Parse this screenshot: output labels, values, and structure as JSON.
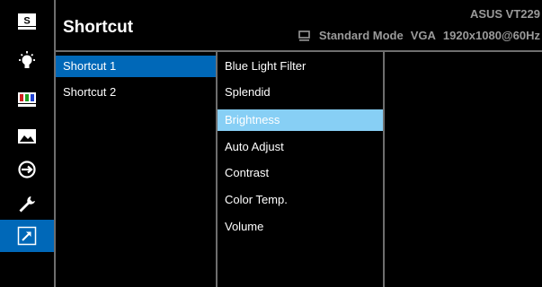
{
  "header": {
    "title": "Shortcut",
    "model": "ASUS VT229",
    "status": {
      "mode": "Standard Mode",
      "input": "VGA",
      "resolution": "1920x1080@60Hz"
    }
  },
  "sidebar": {
    "items": [
      {
        "icon": "splendid-s-icon"
      },
      {
        "icon": "blue-light-filter-icon"
      },
      {
        "icon": "color-icon"
      },
      {
        "icon": "image-icon"
      },
      {
        "icon": "input-select-icon"
      },
      {
        "icon": "system-setup-wrench-icon"
      },
      {
        "icon": "shortcut-arrow-icon",
        "active": true
      }
    ]
  },
  "shortcut_list": [
    {
      "label": "Shortcut 1",
      "selected": true
    },
    {
      "label": "Shortcut 2",
      "selected": false
    }
  ],
  "options": [
    {
      "label": "Blue Light Filter"
    },
    {
      "label": "Splendid"
    },
    {
      "label": "Brightness",
      "highlighted": true
    },
    {
      "label": "Auto Adjust"
    },
    {
      "label": "Contrast"
    },
    {
      "label": "Color Temp."
    },
    {
      "label": "Volume"
    }
  ],
  "colors": {
    "accent": "#0068b8",
    "highlight": "#87cff5",
    "background": "#000000",
    "muted_text": "#9a9a9a"
  }
}
